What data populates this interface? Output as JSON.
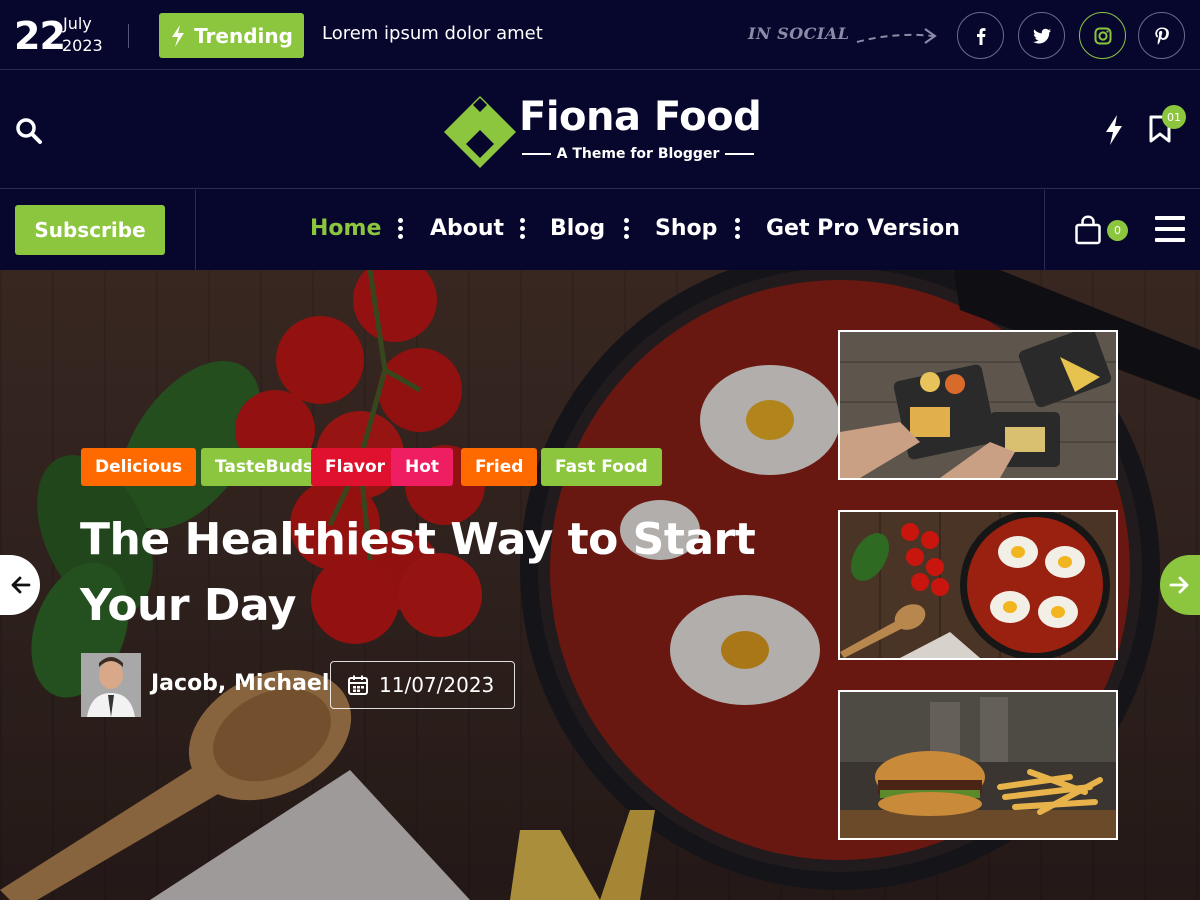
{
  "topbar": {
    "day": "22",
    "month": "July",
    "year": "2023",
    "trending_label": "Trending",
    "ticker_text": "Lorem ipsum dolor amet",
    "social_label": "IN SOCIAL",
    "social_links": [
      "facebook-icon",
      "twitter-icon",
      "instagram-icon",
      "pinterest-icon"
    ]
  },
  "header": {
    "site_name": "Fiona Food",
    "tagline": "A Theme for Blogger",
    "bookmark_count": "01"
  },
  "nav": {
    "subscribe_label": "Subscribe",
    "items": [
      {
        "label": "Home",
        "active": true
      },
      {
        "label": "About",
        "active": false
      },
      {
        "label": "Blog",
        "active": false
      },
      {
        "label": "Shop",
        "active": false
      },
      {
        "label": "Get Pro Version",
        "active": false
      }
    ],
    "cart_count": "0"
  },
  "hero": {
    "tags": [
      {
        "label": "Delicious",
        "color": "#ff6a00"
      },
      {
        "label": "TasteBuds",
        "color": "#8cc63f"
      },
      {
        "label": "Flavor",
        "color": "#e0102f"
      },
      {
        "label": "Hot",
        "color": "#ef1e63"
      },
      {
        "label": "Fried",
        "color": "#ff6a00"
      },
      {
        "label": "Fast Food",
        "color": "#8cc63f"
      }
    ],
    "title": "The Healthiest Way to Start Your Day",
    "author": "Jacob, Michael",
    "date": "11/07/2023"
  },
  "colors": {
    "background": "#07072e",
    "accent": "#8cc63f"
  }
}
